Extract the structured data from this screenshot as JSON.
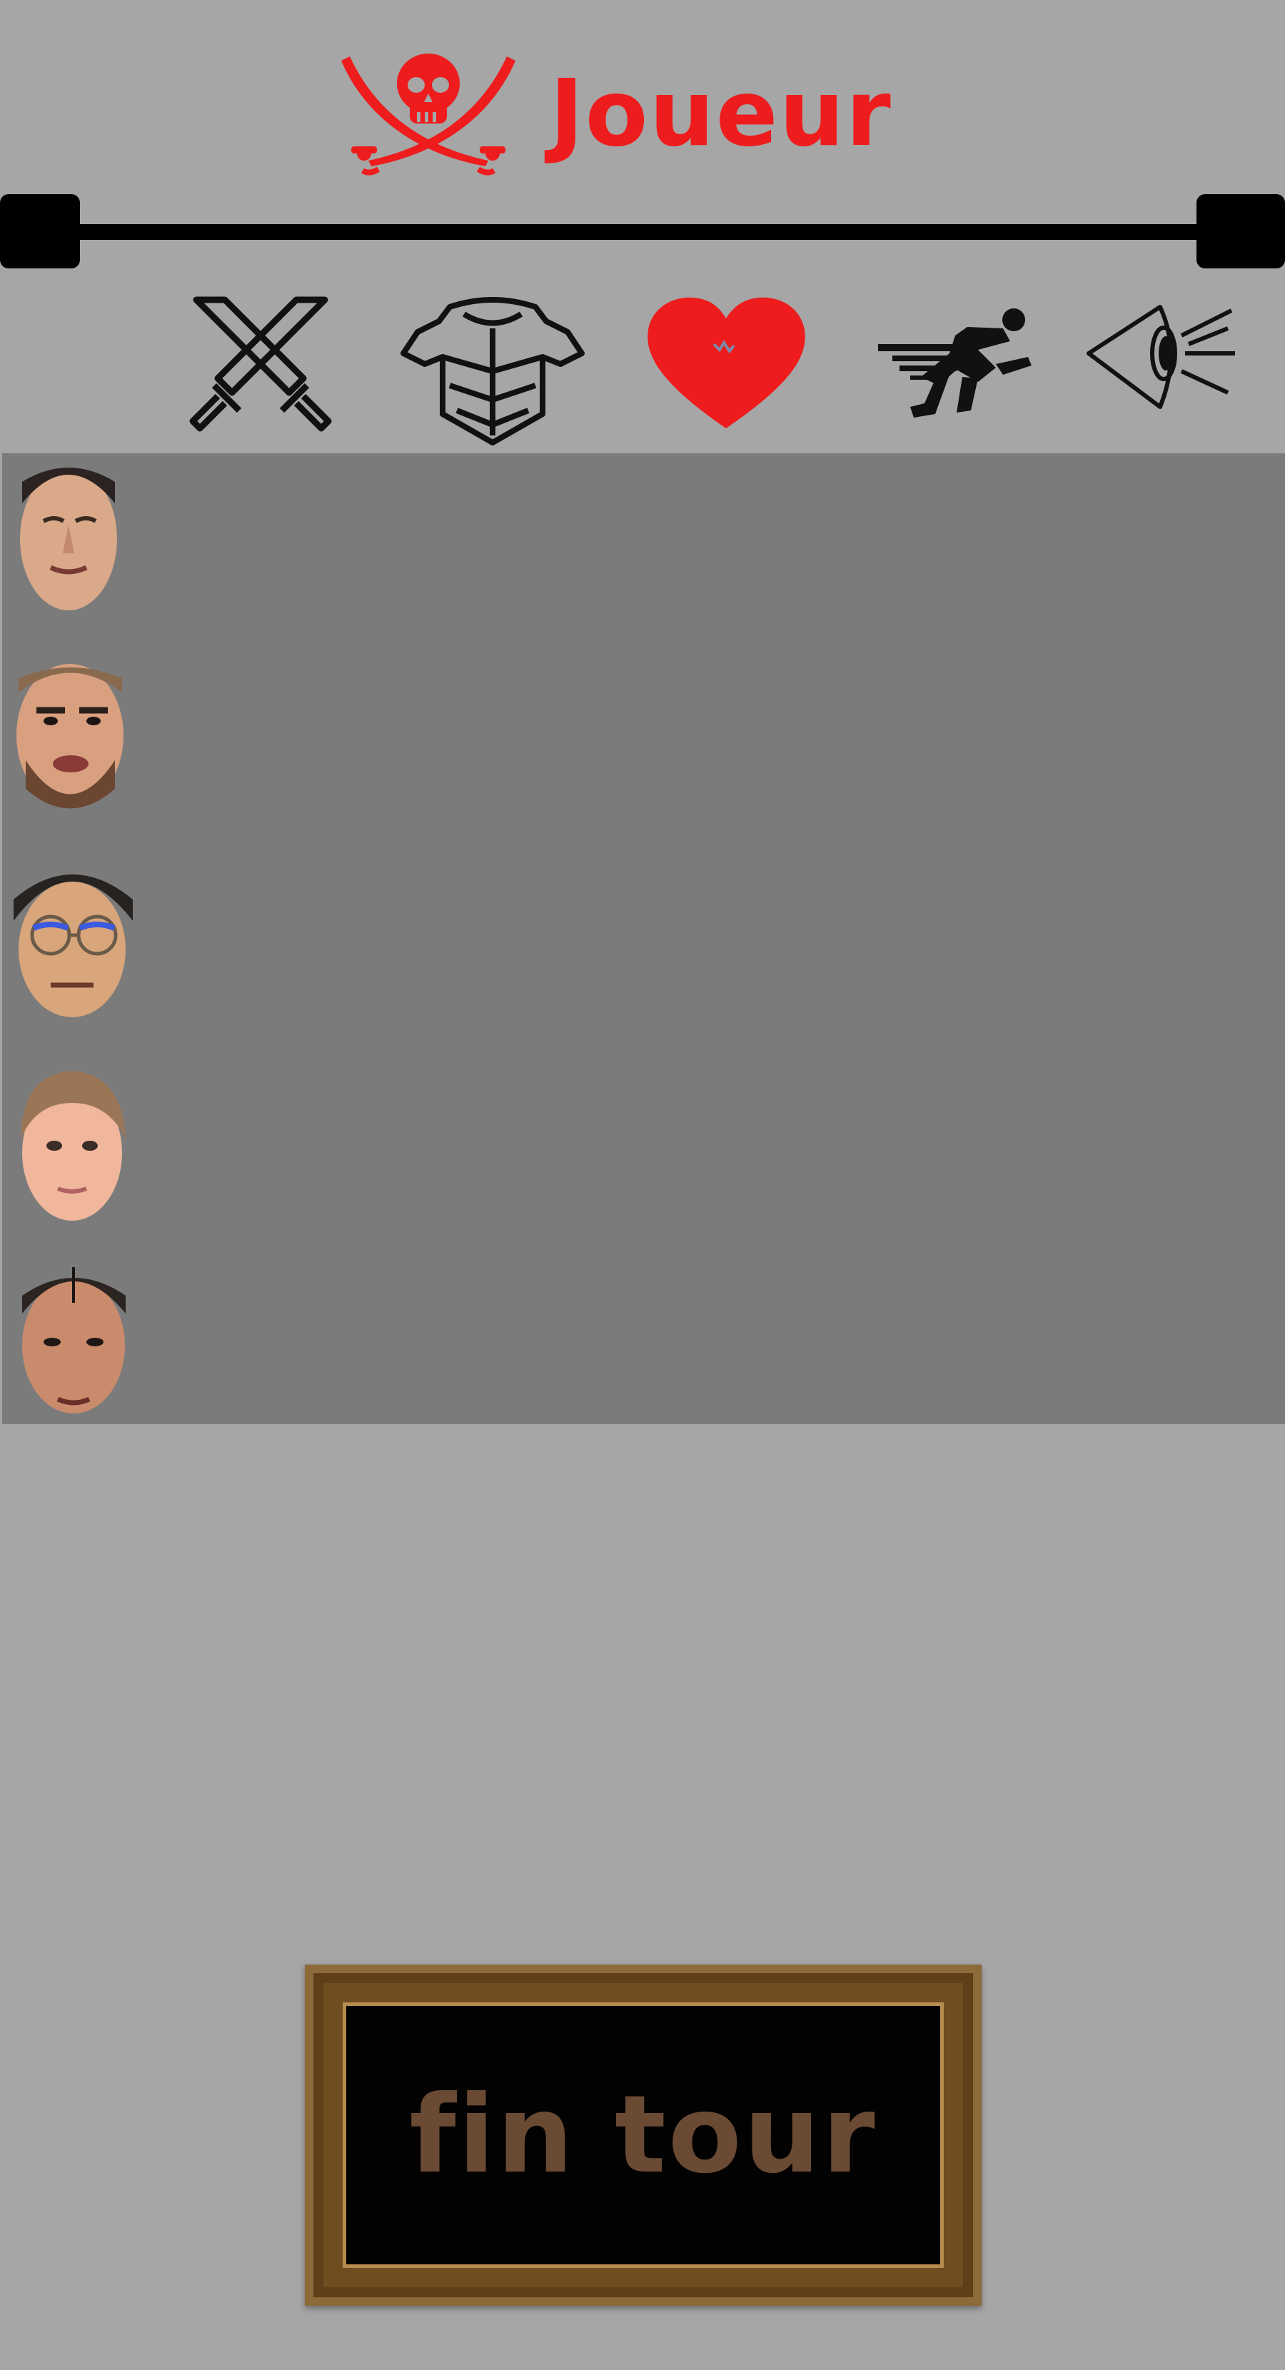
{
  "header": {
    "title": "Joueur",
    "logo_icon": "skull-crossed-sabres-icon",
    "title_color": "#ee1c1c"
  },
  "stats_bar": {
    "icons": [
      "crossed-swords-icon",
      "chest-armor-icon",
      "heart-icon",
      "running-figure-icon",
      "eye-icon"
    ],
    "active_color": "#ee1c1c"
  },
  "players": [
    {
      "name": "player-1"
    },
    {
      "name": "player-2"
    },
    {
      "name": "player-3"
    },
    {
      "name": "player-4"
    },
    {
      "name": "player-5"
    }
  ],
  "end_turn_button": {
    "label": "fin tour",
    "frame_color": "#6f4d21",
    "text_color": "#6b4a34"
  },
  "colors": {
    "background": "#a6a6a6",
    "panel": "#7b7b7b"
  }
}
